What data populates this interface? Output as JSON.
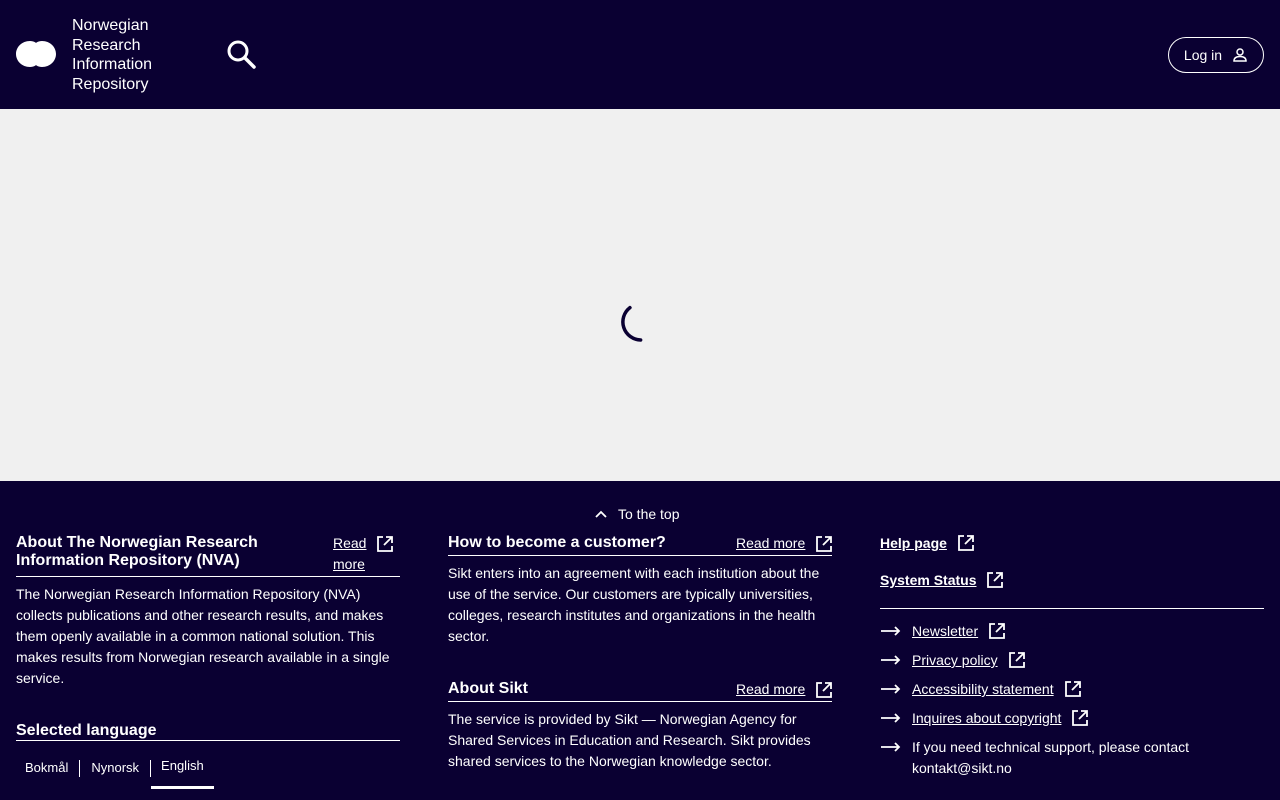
{
  "header": {
    "brand_lines": [
      "Norwegian",
      "Research",
      "Information",
      "Repository"
    ],
    "login_label": "Log in"
  },
  "footer": {
    "to_top_label": "To the top",
    "about_nva": {
      "heading_line1": "About The Norwegian Research",
      "heading_line2": "Information Repository (NVA)",
      "read_more_line1": "Read",
      "read_more_line2": "more",
      "text": "The Norwegian Research Information Repository (NVA) collects publications and other research results, and makes them openly available in a common national solution. This makes results from Norwegian research available in a single service."
    },
    "selected_language": {
      "heading": "Selected language",
      "options": [
        "Bokmål",
        "Nynorsk",
        "English"
      ],
      "active": "English"
    },
    "customer": {
      "heading": "How to become a customer?",
      "read_more": "Read more",
      "text": "Sikt enters into an agreement with each institution about the use of the service. Our customers are typically universities, colleges, research institutes and organizations in the health sector."
    },
    "about_sikt": {
      "heading": "About Sikt",
      "read_more": "Read more",
      "text": "The service is provided by Sikt — Norwegian Agency for Shared Services in Education and Research. Sikt provides shared services to the Norwegian knowledge sector."
    },
    "help_page": "Help page",
    "system_status": "System Status",
    "links": {
      "newsletter": "Newsletter",
      "privacy": "Privacy policy",
      "accessibility": "Accessibility statement",
      "copyright": "Inquires about copyright",
      "support_line1": "If you need technical support, please contact",
      "support_line2": "kontakt@sikt.no"
    }
  }
}
